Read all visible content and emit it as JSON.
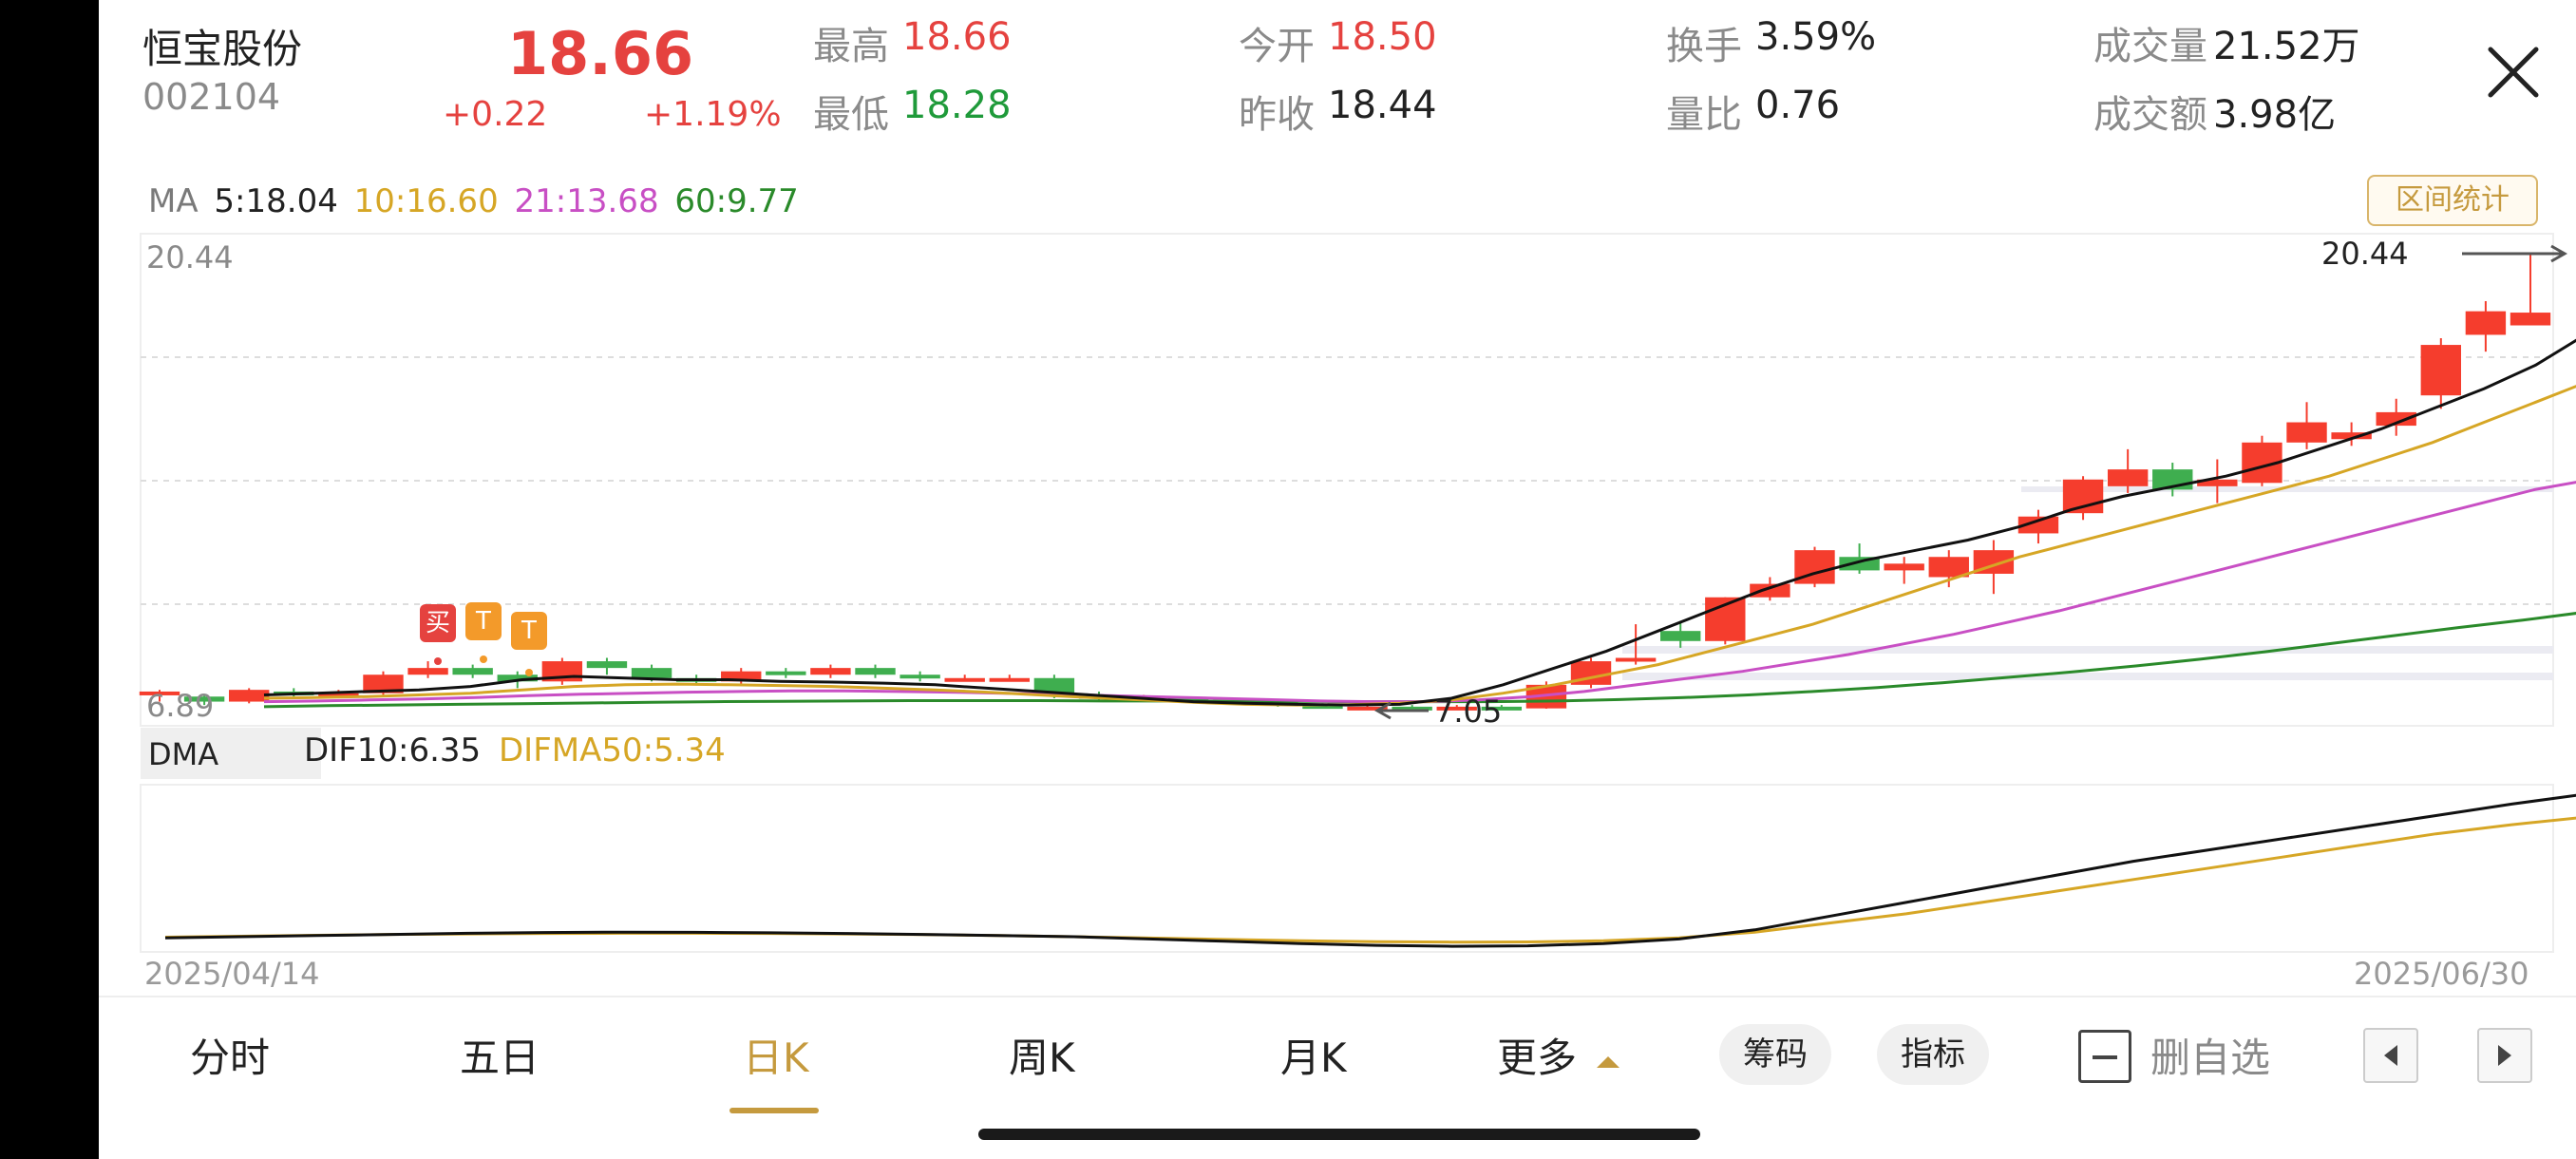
{
  "header": {
    "name": "恒宝股份",
    "code": "002104",
    "price": "18.66",
    "change": "+0.22",
    "change_pct": "+1.19%",
    "high_label": "最高",
    "high": "18.66",
    "low_label": "最低",
    "low": "18.28",
    "open_label": "今开",
    "open": "18.50",
    "prev_close_label": "昨收",
    "prev_close": "18.44",
    "turnover_label": "换手",
    "turnover": "3.59%",
    "vol_ratio_label": "量比",
    "vol_ratio": "0.76",
    "volume_label": "成交量",
    "volume": "21.52万",
    "amount_label": "成交额",
    "amount": "3.98亿"
  },
  "ma": {
    "label": "MA",
    "ma5": "5:18.04",
    "ma10": "10:16.60",
    "ma21": "21:13.68",
    "ma60": "60:9.77"
  },
  "range_button": "区间统计",
  "chart": {
    "max_label": "20.44",
    "max_arrow_label": "20.44",
    "min_label": "6.89",
    "min_arrow_label": "7.05",
    "markers": [
      "买",
      "T",
      "T"
    ]
  },
  "dma": {
    "label": "DMA",
    "dif": "DIF10:6.35",
    "difma": "DIFMA50:5.34"
  },
  "dates": {
    "start": "2025/04/14",
    "end": "2025/06/30"
  },
  "tabs": [
    "分时",
    "五日",
    "日K",
    "周K",
    "月K",
    "更多"
  ],
  "active_tab": "日K",
  "pills": [
    "筹码",
    "指标"
  ],
  "watchlist_label": "删自选",
  "colors": {
    "up": "#f53d2d",
    "down": "#3fae4f",
    "ma5": "#111111",
    "ma10": "#d6a625",
    "ma21": "#c84fc4",
    "ma60": "#2a8a2a",
    "accent": "#c59a3e"
  },
  "chart_data": {
    "type": "candlestick",
    "y_range": [
      6.89,
      20.44
    ],
    "candles": [
      [
        7.3,
        7.4,
        7.1,
        7.45
      ],
      [
        7.25,
        7.1,
        7.0,
        7.3
      ],
      [
        7.1,
        7.45,
        7.05,
        7.5
      ],
      [
        7.4,
        7.3,
        7.2,
        7.5
      ],
      [
        7.3,
        7.35,
        7.2,
        7.45
      ],
      [
        7.35,
        7.9,
        7.3,
        8.0
      ],
      [
        7.9,
        8.1,
        7.8,
        8.3
      ],
      [
        8.1,
        7.9,
        7.8,
        8.2
      ],
      [
        7.9,
        7.7,
        7.5,
        8.0
      ],
      [
        7.7,
        8.3,
        7.6,
        8.4
      ],
      [
        8.3,
        8.1,
        7.9,
        8.4
      ],
      [
        8.1,
        7.8,
        7.7,
        8.2
      ],
      [
        7.8,
        7.7,
        7.6,
        7.9
      ],
      [
        7.7,
        8.0,
        7.6,
        8.1
      ],
      [
        8.0,
        7.9,
        7.8,
        8.1
      ],
      [
        7.9,
        8.1,
        7.8,
        8.2
      ],
      [
        8.1,
        7.9,
        7.8,
        8.2
      ],
      [
        7.9,
        7.8,
        7.7,
        8.0
      ],
      [
        7.8,
        7.8,
        7.7,
        7.9
      ],
      [
        7.8,
        7.8,
        7.7,
        7.9
      ],
      [
        7.8,
        7.3,
        7.2,
        7.9
      ],
      [
        7.3,
        7.2,
        7.1,
        7.4
      ],
      [
        7.2,
        7.2,
        7.1,
        7.3
      ],
      [
        7.2,
        7.15,
        7.1,
        7.25
      ],
      [
        7.15,
        7.1,
        7.05,
        7.2
      ],
      [
        7.1,
        7.0,
        6.95,
        7.15
      ],
      [
        7.0,
        6.9,
        6.89,
        7.05
      ],
      [
        6.9,
        6.95,
        6.89,
        7.0
      ],
      [
        6.95,
        6.92,
        6.89,
        7.0
      ],
      [
        6.92,
        6.95,
        6.89,
        7.0
      ],
      [
        6.95,
        6.9,
        6.89,
        7.0
      ],
      [
        6.9,
        7.6,
        6.89,
        7.7
      ],
      [
        7.6,
        8.3,
        7.5,
        8.4
      ],
      [
        8.3,
        8.4,
        8.2,
        9.4
      ],
      [
        9.2,
        8.9,
        8.7,
        9.5
      ],
      [
        8.9,
        10.2,
        8.8,
        10.2
      ],
      [
        10.2,
        10.6,
        10.1,
        10.8
      ],
      [
        10.6,
        11.6,
        10.5,
        11.7
      ],
      [
        11.4,
        11.0,
        10.9,
        11.8
      ],
      [
        11.0,
        11.2,
        10.6,
        11.4
      ],
      [
        10.8,
        11.4,
        10.5,
        11.6
      ],
      [
        10.9,
        11.6,
        10.3,
        11.9
      ],
      [
        12.1,
        12.6,
        11.8,
        12.8
      ],
      [
        12.7,
        13.7,
        12.5,
        13.8
      ],
      [
        13.5,
        14.0,
        13.3,
        14.6
      ],
      [
        14.0,
        13.4,
        13.2,
        14.2
      ],
      [
        13.5,
        13.7,
        13.0,
        14.3
      ],
      [
        13.6,
        14.8,
        13.5,
        15.0
      ],
      [
        14.8,
        15.4,
        14.6,
        16.0
      ],
      [
        14.9,
        15.1,
        14.7,
        15.4
      ],
      [
        15.3,
        15.7,
        15.0,
        16.1
      ],
      [
        16.2,
        17.7,
        15.8,
        17.9
      ],
      [
        18.0,
        18.7,
        17.5,
        19.0
      ],
      [
        18.28,
        18.66,
        18.28,
        20.44
      ]
    ],
    "ma5": [
      7.3,
      7.35,
      7.4,
      7.45,
      7.55,
      7.75,
      7.85,
      7.8,
      7.75,
      7.75,
      7.7,
      7.68,
      7.65,
      7.6,
      7.5,
      7.4,
      7.3,
      7.2,
      7.1,
      7.05,
      7.02,
      7.0,
      7.02,
      7.2,
      7.6,
      8.1,
      8.6,
      9.2,
      9.8,
      10.4,
      10.9,
      11.3,
      11.6,
      11.9,
      12.3,
      12.8,
      13.2,
      13.5,
      13.8,
      14.2,
      14.7,
      15.2,
      15.8,
      16.4,
      17.1,
      18.04
    ],
    "ma10": [
      7.2,
      7.22,
      7.25,
      7.3,
      7.35,
      7.45,
      7.55,
      7.6,
      7.62,
      7.6,
      7.58,
      7.55,
      7.5,
      7.45,
      7.38,
      7.3,
      7.22,
      7.15,
      7.08,
      7.02,
      7.0,
      7.01,
      7.05,
      7.15,
      7.35,
      7.6,
      7.9,
      8.2,
      8.6,
      9.0,
      9.4,
      9.9,
      10.4,
      10.9,
      11.4,
      11.8,
      12.2,
      12.6,
      13.0,
      13.4,
      13.8,
      14.3,
      14.8,
      15.4,
      16.0,
      16.6
    ],
    "ma21": [
      7.1,
      7.12,
      7.15,
      7.18,
      7.22,
      7.28,
      7.32,
      7.35,
      7.38,
      7.4,
      7.42,
      7.42,
      7.4,
      7.38,
      7.35,
      7.32,
      7.28,
      7.24,
      7.2,
      7.16,
      7.12,
      7.1,
      7.1,
      7.15,
      7.25,
      7.4,
      7.6,
      7.8,
      8.0,
      8.25,
      8.5,
      8.8,
      9.1,
      9.45,
      9.8,
      10.2,
      10.6,
      11.0,
      11.4,
      11.8,
      12.2,
      12.6,
      13.0,
      13.4,
      13.68
    ],
    "ma60": [
      6.95,
      6.98,
      7.0,
      7.02,
      7.04,
      7.06,
      7.08,
      7.1,
      7.11,
      7.12,
      7.13,
      7.13,
      7.13,
      7.12,
      7.12,
      7.11,
      7.11,
      7.1,
      7.1,
      7.1,
      7.12,
      7.16,
      7.22,
      7.3,
      7.4,
      7.52,
      7.66,
      7.82,
      7.98,
      8.16,
      8.36,
      8.58,
      8.82,
      9.06,
      9.3,
      9.52,
      9.77
    ],
    "dif": [
      0.05,
      0.1,
      0.15,
      0.2,
      0.25,
      0.28,
      0.3,
      0.29,
      0.27,
      0.24,
      0.2,
      0.15,
      0.1,
      0.0,
      -0.1,
      -0.2,
      -0.28,
      -0.32,
      -0.3,
      -0.2,
      0.0,
      0.4,
      1.0,
      1.6,
      2.2,
      2.8,
      3.4,
      3.9,
      4.4,
      4.9,
      5.4,
      5.9,
      6.35
    ],
    "difma": [
      0.08,
      0.12,
      0.16,
      0.2,
      0.22,
      0.24,
      0.25,
      0.25,
      0.24,
      0.22,
      0.19,
      0.15,
      0.1,
      0.04,
      -0.02,
      -0.08,
      -0.12,
      -0.14,
      -0.13,
      -0.08,
      0.05,
      0.3,
      0.7,
      1.1,
      1.6,
      2.1,
      2.6,
      3.1,
      3.6,
      4.1,
      4.6,
      5.0,
      5.34
    ]
  }
}
